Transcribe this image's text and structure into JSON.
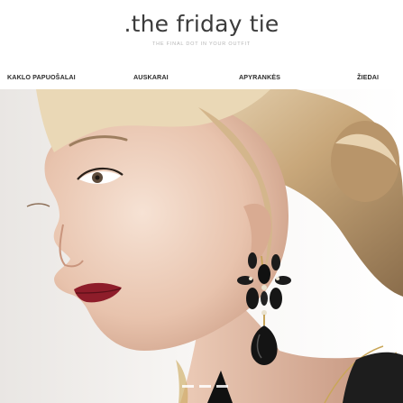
{
  "header": {
    "logo": ".the friday tie",
    "tagline": "THE FINAL DOT IN YOUR OUTFIT"
  },
  "nav": {
    "items": [
      {
        "label": "KAKLO PAPUOŠALAI"
      },
      {
        "label": "AUSKARAI"
      },
      {
        "label": "APYRANKĖS"
      },
      {
        "label": "ŽIEDAI"
      }
    ]
  },
  "hero": {
    "image": "model-portrait-with-black-drop-earring",
    "lip_color": "#8e1d2a",
    "gem_color": "#141414"
  },
  "carousel": {
    "slide_count": 3,
    "active_index": 0
  }
}
